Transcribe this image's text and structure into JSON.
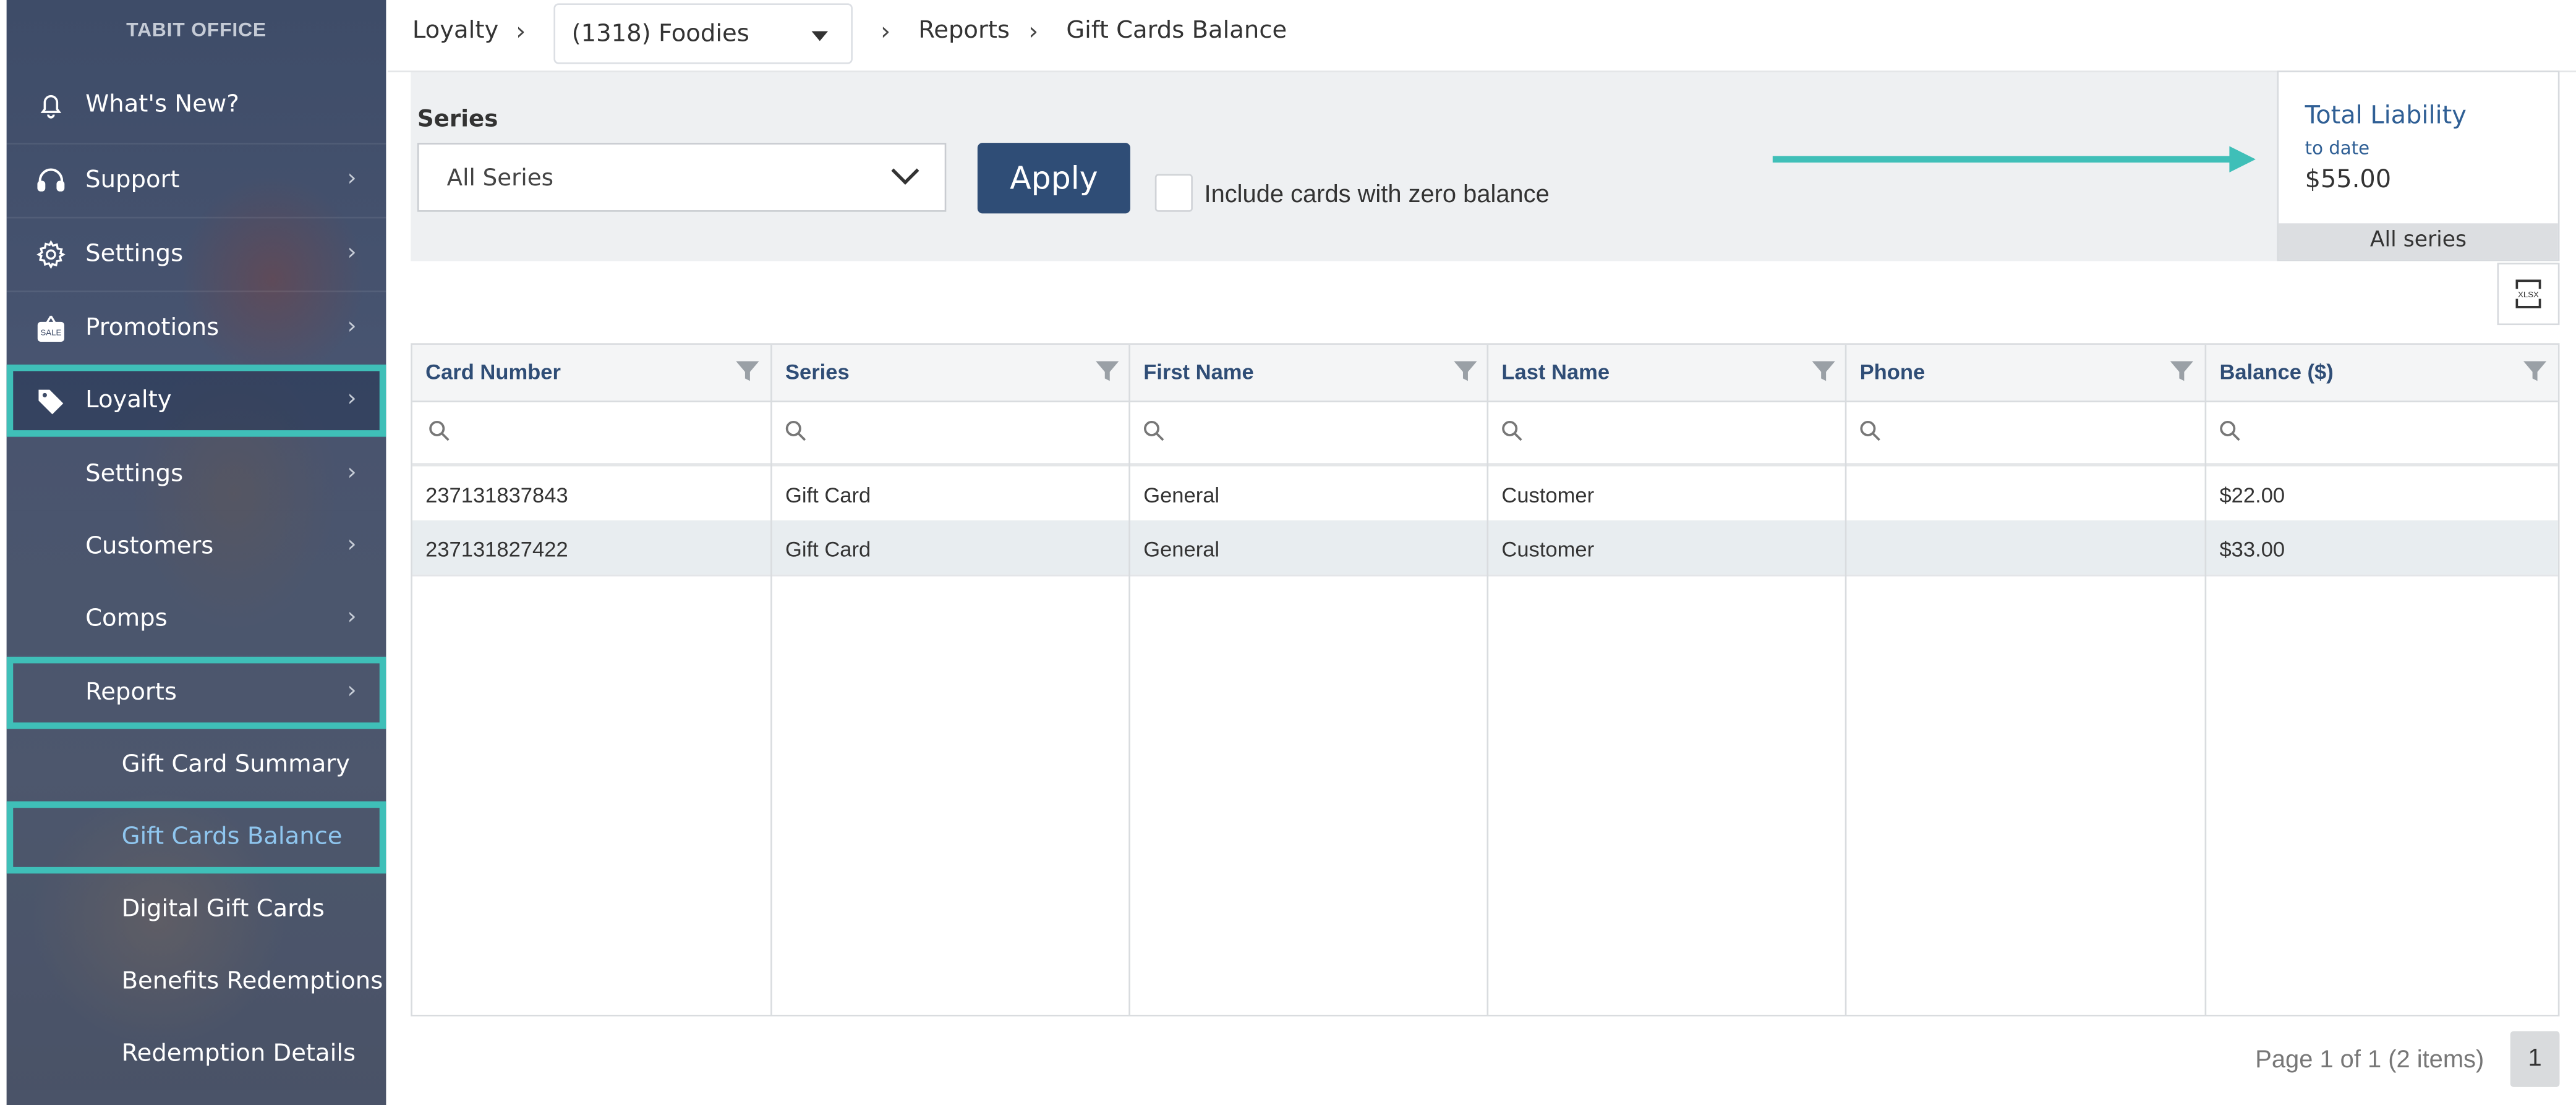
{
  "sidebar": {
    "brand": "TABIT OFFICE",
    "items": [
      {
        "label": "What's New?"
      },
      {
        "label": "Support"
      },
      {
        "label": "Settings"
      },
      {
        "label": "Promotions"
      },
      {
        "label": "Loyalty"
      },
      {
        "label": "Settings"
      },
      {
        "label": "Customers"
      },
      {
        "label": "Comps"
      },
      {
        "label": "Reports"
      },
      {
        "label": "Gift Card Summary"
      },
      {
        "label": "Gift Cards Balance"
      },
      {
        "label": "Digital Gift Cards"
      },
      {
        "label": "Benefits Redemptions"
      },
      {
        "label": "Redemption Details"
      }
    ],
    "chevron": "›"
  },
  "breadcrumb": {
    "loyalty": "Loyalty",
    "org": "(1318) Foodies",
    "reports": "Reports",
    "current": "Gift Cards Balance",
    "sep": "›"
  },
  "filters": {
    "series_label": "Series",
    "series_value": "All Series",
    "apply_label": "Apply",
    "zero_balance_label": "Include cards with zero balance"
  },
  "liability": {
    "title": "Total Liability",
    "subtitle": "to date",
    "amount": "$55.00",
    "footer": "All series"
  },
  "table": {
    "columns": [
      "Card Number",
      "Series",
      "First Name",
      "Last Name",
      "Phone",
      "Balance ($)"
    ],
    "rows": [
      [
        "237131837843",
        "Gift Card",
        "General",
        "Customer",
        "",
        "$22.00"
      ],
      [
        "237131827422",
        "Gift Card",
        "General",
        "Customer",
        "",
        "$33.00"
      ]
    ]
  },
  "pager": {
    "info": "Page 1 of 1 (2 items)",
    "page": "1"
  },
  "colors": {
    "accent": "#3fbfb8",
    "primary": "#2f4d76",
    "link": "#2f5f95",
    "active_nav": "#8fc6ef"
  }
}
